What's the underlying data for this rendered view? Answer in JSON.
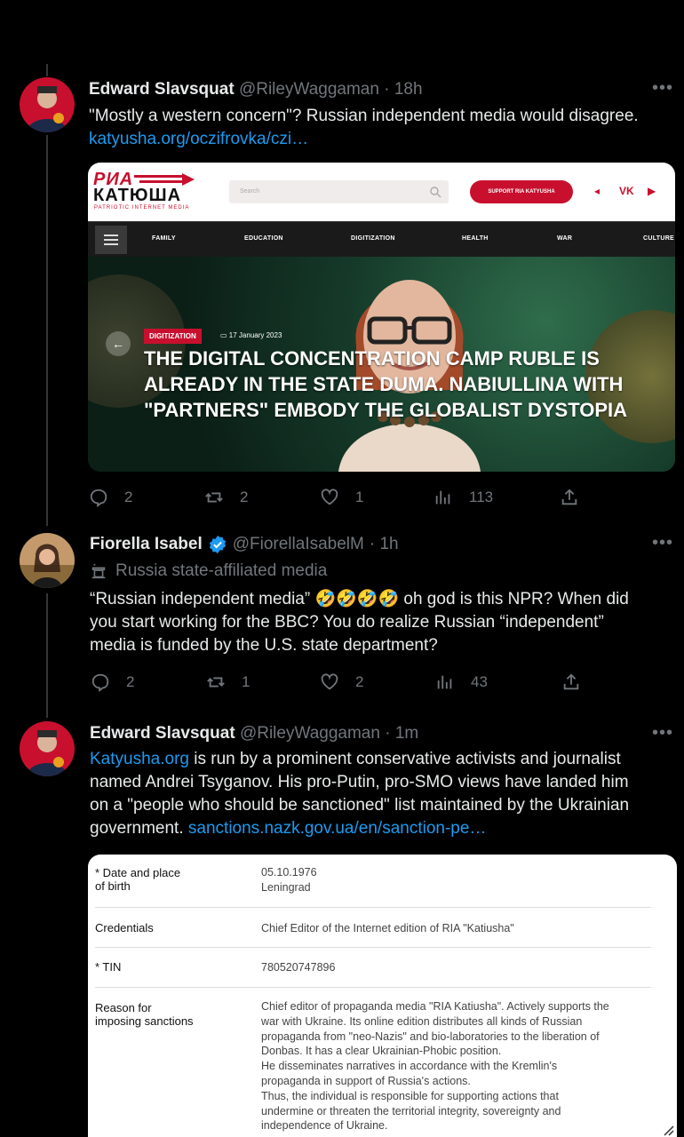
{
  "tweets": [
    {
      "name": "Edward Slavsquat",
      "handle": "@RileyWaggaman",
      "time": "· 18h",
      "text": "\"Mostly a western concern\"? Russian independent media would disagree.",
      "link": "katyusha.org/oczifrovka/czi…",
      "stats": {
        "replies": "2",
        "retweets": "2",
        "likes": "1",
        "views": "113"
      }
    },
    {
      "name": "Fiorella Isabel",
      "handle": "@FiorellaIsabelM",
      "time": "· 1h",
      "label": "Russia state-affiliated media",
      "text_lines": [
        "“Russian independent media” 🤣🤣🤣🤣 oh god is this NPR? When did",
        "you start working for the BBC? You do realize Russian “independent”",
        "media is funded by the U.S. state department?"
      ],
      "stats": {
        "replies": "2",
        "retweets": "1",
        "likes": "2",
        "views": "43"
      }
    },
    {
      "name": "Edward Slavsquat",
      "handle": "@RileyWaggaman",
      "time": "· 1m",
      "text_link": "Katyusha.org",
      "text_lines": [
        " is run by a prominent conservative activists and journalist",
        "named Andrei Tsyganov. His pro-Putin, pro-SMO views have landed him",
        "on a \"people who should be sanctioned\" list maintained by the Ukrainian",
        "government. "
      ],
      "link": "sanctions.nazk.gov.ua/en/sanction-pe…"
    }
  ],
  "card": {
    "logo_top": "РИА",
    "logo_bottom": "КАТЮША",
    "logo_sub": "PATRIOTIC INTERNET MEDIA",
    "search_placeholder": "Search",
    "support": "SUPPORT RIA KATYUSHA",
    "social": [
      "◂",
      "VK",
      "▶"
    ],
    "nav": [
      "FAMILY",
      "EDUCATION",
      "DIGITIZATION",
      "HEALTH",
      "WAR",
      "CULTURE"
    ],
    "tag": "DIGITIZATION",
    "date": "17 January 2023",
    "headline_lines": [
      "THE DIGITAL CONCENTRATION CAMP RUBLE IS",
      "ALREADY IN THE STATE DUMA. NABIULLINA WITH",
      "\"PARTNERS\" EMBODY THE GLOBALIST DYSTOPIA"
    ]
  },
  "sanctions": [
    {
      "label": [
        "* Date and place",
        "of birth"
      ],
      "value": [
        "05.10.1976",
        "Leningrad"
      ]
    },
    {
      "label": [
        "Credentials"
      ],
      "value": [
        "Chief Editor of the Internet edition of RIA \"Katiusha\""
      ]
    },
    {
      "label": [
        "* TIN"
      ],
      "value": [
        "780520747896"
      ]
    },
    {
      "label": [
        "Reason for",
        "imposing sanctions"
      ],
      "value": [
        "Chief editor of propaganda media \"RIA Katiusha\". Actively supports the",
        "war with Ukraine. Its online edition distributes all kinds of Russian",
        "propaganda from \"neo-Nazis\" and bio-laboratories to the liberation of",
        "Donbas. It has a clear Ukrainian-Phobic position.",
        "He disseminates narratives in accordance with the Kremlin's",
        "propaganda in support of Russia's actions.",
        "Thus, the individual is responsible for supporting actions that",
        "undermine or threaten the territorial integrity, sovereignty and",
        "independence of Ukraine."
      ]
    }
  ],
  "colors": {
    "link": "#1d9bf0",
    "muted": "#71767b",
    "brand_red": "#c8102e",
    "verified": "#1d9bf0"
  },
  "icons": [
    "reply-icon",
    "retweet-icon",
    "like-icon",
    "views-icon",
    "share-icon",
    "more-icon",
    "verified-icon",
    "state-media-icon"
  ]
}
